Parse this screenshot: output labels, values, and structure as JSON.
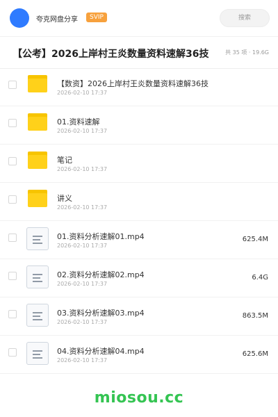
{
  "header": {
    "app_name": "夸克网盘分享",
    "badge": "SVIP",
    "search_label": "搜索"
  },
  "share": {
    "title": "【公考】2026上岸村王炎数量资料速解36技",
    "count": "共 35 项",
    "separator": "·",
    "size": "19.6G"
  },
  "files": [
    {
      "type": "folder",
      "name": "【数资】2026上岸村王炎数量资料速解36技",
      "date": "2026-02-10 17:37",
      "size": ""
    },
    {
      "type": "folder",
      "name": "01.资料速解",
      "date": "2026-02-10 17:37",
      "size": ""
    },
    {
      "type": "folder",
      "name": "笔记",
      "date": "2026-02-10 17:37",
      "size": ""
    },
    {
      "type": "folder",
      "name": "讲义",
      "date": "2026-02-10 17:37",
      "size": ""
    },
    {
      "type": "file",
      "name": "01.资料分析速解01.mp4",
      "date": "2026-02-10 17:37",
      "size": "625.4M"
    },
    {
      "type": "file",
      "name": "02.资料分析速解02.mp4",
      "date": "2026-02-10 17:37",
      "size": "6.4G"
    },
    {
      "type": "file",
      "name": "03.资料分析速解03.mp4",
      "date": "2026-02-10 17:37",
      "size": "863.5M"
    },
    {
      "type": "file",
      "name": "04.资料分析速解04.mp4",
      "date": "2026-02-10 17:37",
      "size": "625.6M"
    }
  ],
  "watermark": "miosou.cc",
  "colors": {
    "accent": "#2f7bff",
    "svip": "#f7a13d",
    "folder": "#ffd11a",
    "watermark": "#34c452"
  },
  "icons": {
    "folder": "folder-icon",
    "file": "video-file-icon",
    "avatar": "avatar"
  }
}
